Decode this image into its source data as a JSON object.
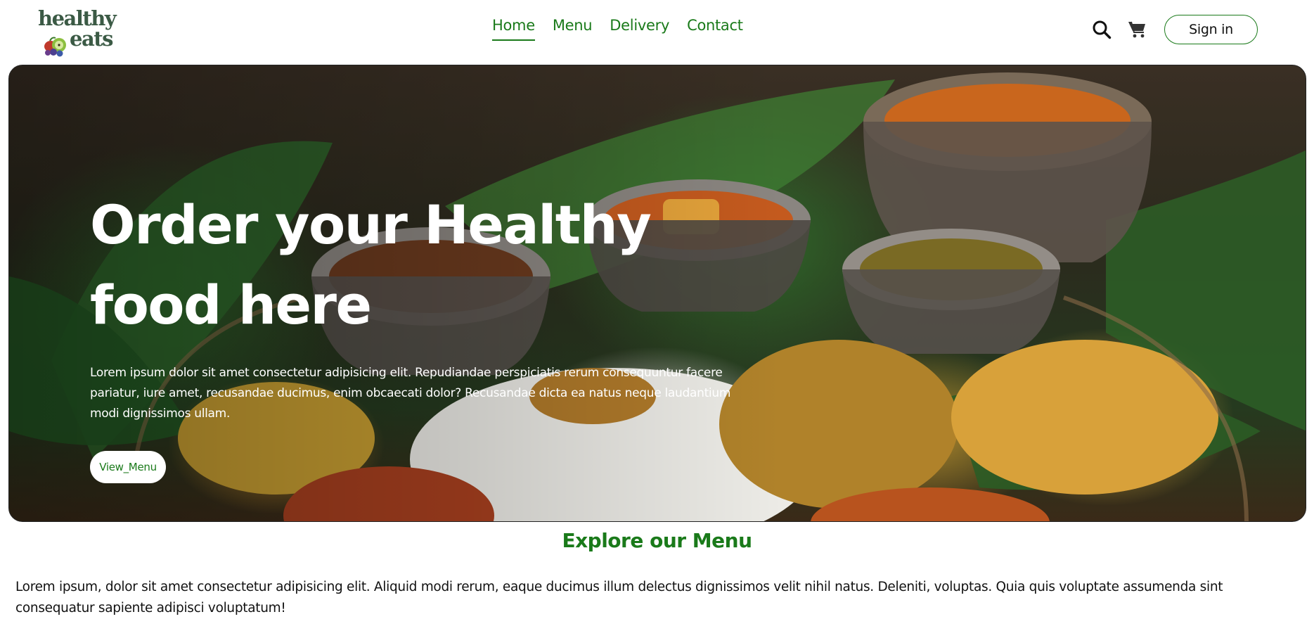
{
  "logo": {
    "line1": "healthy",
    "line2": "eats"
  },
  "nav": {
    "items": [
      {
        "label": "Home",
        "active": true
      },
      {
        "label": "Menu",
        "active": false
      },
      {
        "label": "Delivery",
        "active": false
      },
      {
        "label": "Contact",
        "active": false
      }
    ]
  },
  "header_actions": {
    "search_icon": "search-icon",
    "cart_icon": "cart-icon",
    "signin_label": "Sign in"
  },
  "hero": {
    "title_line1": "Order your Healthy",
    "title_line2": "food here",
    "text": "Lorem ipsum dolor sit amet consectetur adipisicing elit. Repudiandae perspiciatis rerum consequuntur facere pariatur, iure amet, recusandae ducimus, enim obcaecati dolor? Recusandae dicta ea natus neque laudantium modi dignissimos ullam.",
    "button_label": "View_Menu"
  },
  "explore": {
    "title": "Explore our Menu",
    "text": "Lorem ipsum, dolor sit amet consectetur adipisicing elit. Aliquid modi rerum, eaque ducimus illum delectus dignissimos velit nihil natus. Deleniti, voluptas. Quia quis voluptate assumenda sint consequatur sapiente adipisci voluptatum!"
  },
  "colors": {
    "brand_green": "#1a7a1a",
    "logo_green": "#3b5a45",
    "hero_text": "#ffffff"
  }
}
